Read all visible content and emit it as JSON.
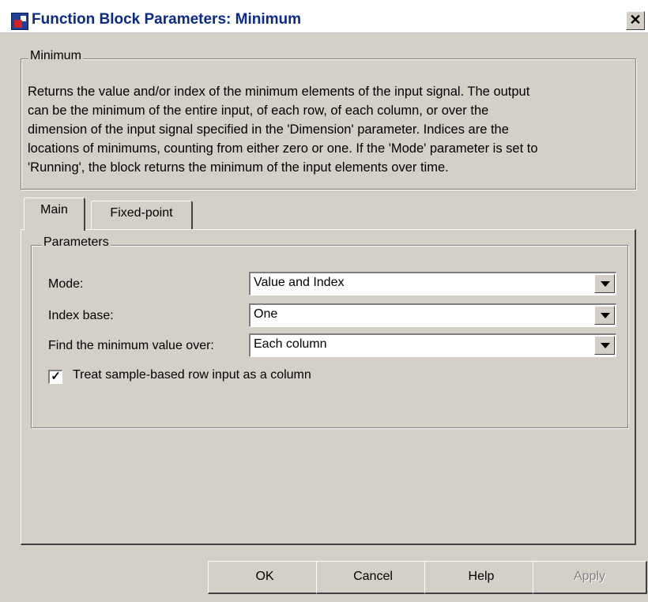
{
  "window": {
    "title": "Function Block Parameters: Minimum",
    "close_glyph": "✕",
    "icon": "simulink-block-icon"
  },
  "block_group": {
    "label": "Minimum",
    "description": "Returns the value and/or index of the minimum elements of the input signal. The output\ncan be the minimum of the entire input, of each row, of each column, or over the\ndimension of the input signal specified in the 'Dimension' parameter. Indices are the\nlocations of minimums, counting from either zero or one. If the 'Mode' parameter is set to\n'Running', the block returns the minimum of the input elements over time."
  },
  "tabs": [
    {
      "label": "Main",
      "active": true
    },
    {
      "label": "Fixed-point",
      "active": false
    }
  ],
  "parameters": {
    "label": "Parameters",
    "mode": {
      "label": "Mode:",
      "value": "Value and Index"
    },
    "index_base": {
      "label": "Index base:",
      "value": "One"
    },
    "find_over": {
      "label": "Find the minimum value over:",
      "value": "Each column"
    },
    "treat_row": {
      "label": "Treat sample-based row input as a column",
      "checked": true,
      "check_glyph": "✓"
    }
  },
  "buttons": {
    "ok": "OK",
    "cancel": "Cancel",
    "help": "Help",
    "apply": "Apply"
  },
  "colors": {
    "face": "#d4d0c8",
    "title_text": "#0a2a8c",
    "disabled_text": "#808080"
  }
}
